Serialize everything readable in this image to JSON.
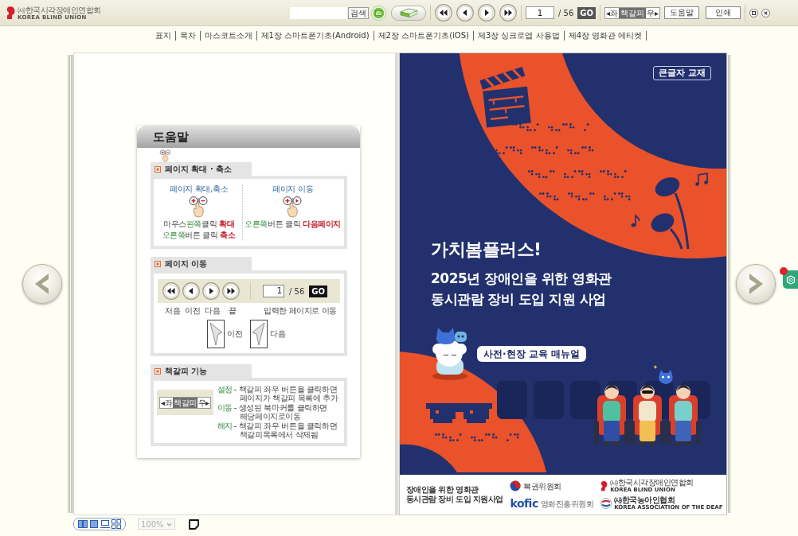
{
  "toolbar": {
    "logo": {
      "name_ko": "㈔한국시각장애인연합회",
      "name_en": "KOREA BLIND UNION"
    },
    "search": {
      "button": "검색"
    },
    "page_input": {
      "value": "1",
      "total": "/ 56",
      "go": "GO"
    },
    "bookmark": {
      "left": "◂좌",
      "label": "책갈피",
      "right": "우▸"
    },
    "buttons": [
      "도움말",
      "인쇄"
    ]
  },
  "chapters": [
    "표지",
    "목차",
    "마스코트소개",
    "제1장 스마트폰기초(Android)",
    "제2장 스마트폰기초(iOS)",
    "제3장 싱크로앱 사용법",
    "제4장 영화관 에티켓"
  ],
  "help": {
    "title": "도움말",
    "zoom_section": {
      "title": "페이지 확대 · 축소",
      "columns": [
        {
          "heading": "페이지 확대,축소",
          "lines": [
            [
              {
                "text": "마우스",
                "kind": "plain"
              },
              {
                "text": "왼쪽",
                "kind": "key"
              },
              {
                "text": "클릭 ",
                "kind": "plain"
              },
              {
                "text": "확대",
                "kind": "action"
              }
            ],
            [
              {
                "text": "오른쪽",
                "kind": "key"
              },
              {
                "text": "버튼 클릭 ",
                "kind": "plain"
              },
              {
                "text": "축소",
                "kind": "action"
              }
            ]
          ]
        },
        {
          "heading": "페이지 이동",
          "lines": [
            [
              {
                "text": "오른쪽",
                "kind": "key"
              },
              {
                "text": "버튼 클릭 ",
                "kind": "plain"
              },
              {
                "text": "다음페이지",
                "kind": "action"
              }
            ]
          ]
        }
      ]
    },
    "nav_section": {
      "title": "페이지 이동",
      "page_value": "1",
      "page_total": "/ 56",
      "go": "GO",
      "button_labels": [
        "처음",
        "이전",
        "다음",
        "끝"
      ],
      "input_label": "입력한 페이지로 이동",
      "turn_labels": [
        "이전",
        "다음"
      ]
    },
    "bookmark_section": {
      "title": "책갈피 기능",
      "control": {
        "left": "◂좌",
        "label": "책갈피",
        "right": "우▸"
      },
      "entries": [
        {
          "term": "설정",
          "lines": [
            "- 책갈피 좌우 버튼을 클릭하면",
            "페이지가 책갈피 목록에 추가"
          ]
        },
        {
          "term": "이동",
          "lines": [
            "- 생성된 북마커를 클릭하면",
            "해당페이지로이동"
          ]
        },
        {
          "term": "해지",
          "lines": [
            "- 책갈피 좌우 버튼을 클릭하면",
            "책갈피목록에서 삭제됨"
          ]
        }
      ]
    }
  },
  "cover": {
    "badge": "큰글자 교재",
    "title": "가치봄플러스!",
    "subtitle": [
      "2025년 장애인을 위한 영화관",
      "동시관람 장비 도입 지원 사업"
    ],
    "tag": "사전·현장 교육 매뉴얼",
    "footer": {
      "project": [
        "장애인을 위한 영화관",
        "동시관람 장비 도입 지원사업"
      ],
      "logos": [
        {
          "kind": "lottery",
          "name": "복권위원회"
        },
        {
          "kind": "kofic",
          "mark": "kofic",
          "name": "영화진흥위원회"
        },
        {
          "kind": "blind_union",
          "name": "㈔한국시각장애인연합회",
          "name_en": "KOREA BLIND UNION"
        },
        {
          "kind": "deaf_association",
          "name": "㈔한국농아인협회",
          "name_en": "KOREA ASSOCIATION OF THE DEAF"
        }
      ]
    }
  },
  "bottom_bar": {
    "zoom": {
      "value": "100%",
      "disabled": true
    }
  }
}
